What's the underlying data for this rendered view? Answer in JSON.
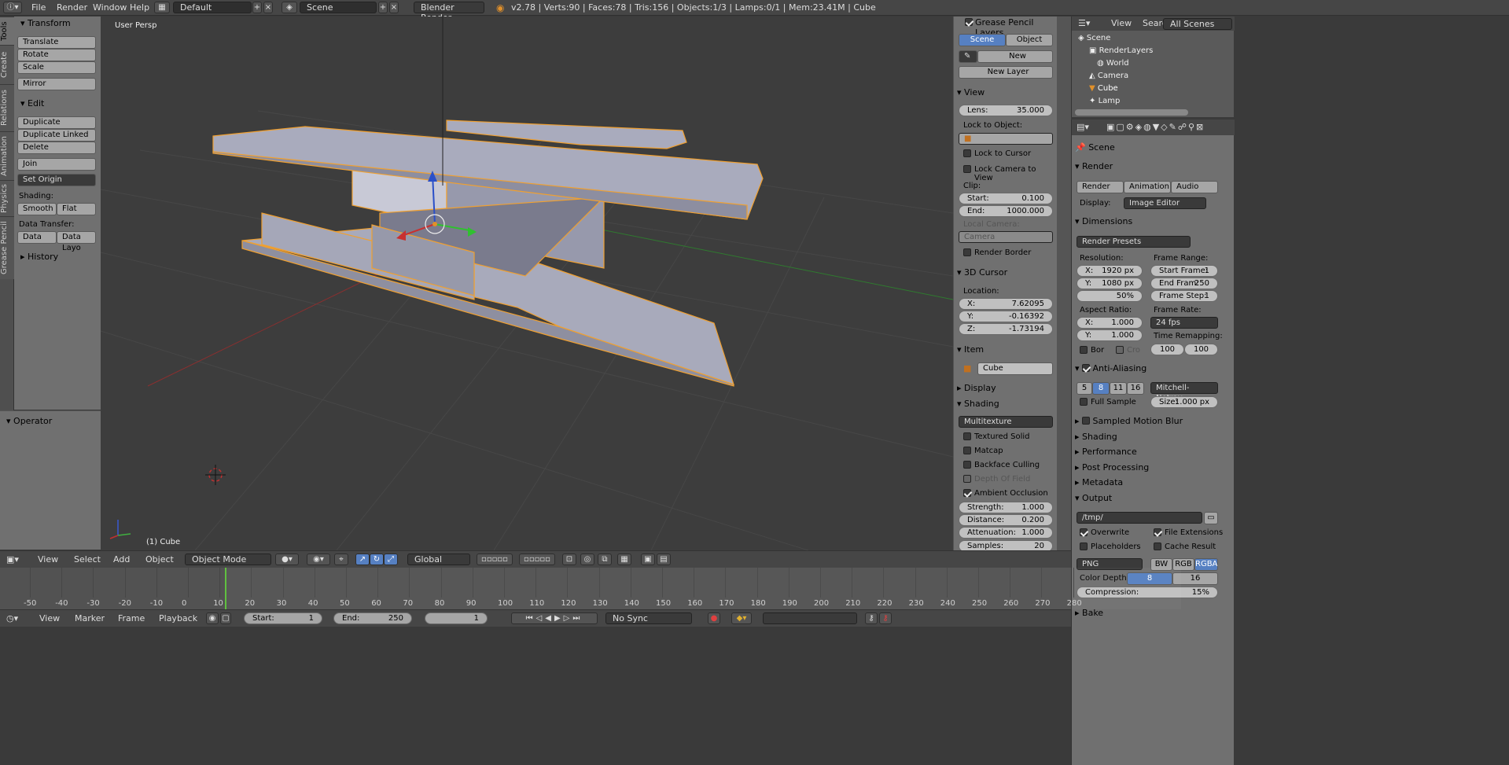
{
  "topbar": {
    "menus": [
      "File",
      "Render",
      "Window",
      "Help"
    ],
    "screen_layout": "Default",
    "scene": "Scene",
    "render_engine": "Blender Render",
    "stats": "v2.78 | Verts:90 | Faces:78 | Tris:156 | Objects:1/3 | Lamps:0/1 | Mem:23.41M | Cube"
  },
  "tool_tabs": [
    "Tools",
    "Create",
    "Relations",
    "Animation",
    "Physics",
    "Grease Pencil"
  ],
  "toolshelf": {
    "transform_title": "Transform",
    "translate": "Translate",
    "rotate": "Rotate",
    "scale": "Scale",
    "mirror": "Mirror",
    "edit_title": "Edit",
    "duplicate": "Duplicate",
    "duplicate_linked": "Duplicate Linked",
    "delete": "Delete",
    "join": "Join",
    "set_origin": "Set Origin",
    "shading_label": "Shading:",
    "smooth": "Smooth",
    "flat": "Flat",
    "data_transfer_label": "Data Transfer:",
    "data": "Data",
    "data_layout": "Data Layo",
    "history_title": "History"
  },
  "operator_title": "Operator",
  "viewport": {
    "view_label": "User Persp",
    "object_label": "(1) Cube"
  },
  "npanel": {
    "grease_pencil_title": "Grease Pencil Layers",
    "scene_btn": "Scene",
    "object_btn": "Object",
    "new_btn": "New",
    "new_layer_btn": "New Layer",
    "view_title": "View",
    "lens_label": "Lens:",
    "lens_value": "35.000",
    "lock_to_object": "Lock to Object:",
    "lock_to_cursor": "Lock to Cursor",
    "lock_camera_to_view": "Lock Camera to View",
    "clip_label": "Clip:",
    "clip_start_label": "Start:",
    "clip_start": "0.100",
    "clip_end_label": "End:",
    "clip_end": "1000.000",
    "local_camera": "Local Camera:",
    "camera_placeholder": "Camera",
    "render_border": "Render Border",
    "cursor_title": "3D Cursor",
    "location_label": "Location:",
    "cx_label": "X:",
    "cx": "7.62095",
    "cy_label": "Y:",
    "cy": "-0.16392",
    "cz_label": "Z:",
    "cz": "-1.73194",
    "item_title": "Item",
    "item_name": "Cube",
    "display_title": "Display",
    "shading_title": "Shading",
    "shading_mode": "Multitexture",
    "textured_solid": "Textured Solid",
    "matcap": "Matcap",
    "backface_culling": "Backface Culling",
    "depth_of_field": "Depth Of Field",
    "ambient_occlusion": "Ambient Occlusion",
    "strength_label": "Strength:",
    "strength": "1.000",
    "distance_label": "Distance:",
    "distance": "0.200",
    "attenuation_label": "Attenuation:",
    "attenuation": "1.000",
    "samples_label": "Samples:",
    "samples": "20"
  },
  "outliner": {
    "view": "View",
    "search": "Search",
    "all_scenes": "All Scenes",
    "items": [
      "Scene",
      "RenderLayers",
      "World",
      "Camera",
      "Cube",
      "Lamp"
    ]
  },
  "properties": {
    "scene_label": "Scene",
    "render_title": "Render",
    "render_btn": "Render",
    "animation_btn": "Animation",
    "audio_btn": "Audio",
    "display_label": "Display:",
    "display_value": "Image Editor",
    "dimensions_title": "Dimensions",
    "render_presets": "Render Presets",
    "resolution_label": "Resolution:",
    "res_x_label": "X:",
    "res_x": "1920 px",
    "res_y_label": "Y:",
    "res_y": "1080 px",
    "res_pct": "50%",
    "frame_range_label": "Frame Range:",
    "start_frame_label": "Start Frame:",
    "start_frame": "1",
    "end_frame_label": "End Fram:",
    "end_frame": "250",
    "frame_step_label": "Frame Step:",
    "frame_step": "1",
    "aspect_label": "Aspect Ratio:",
    "asp_x_label": "X:",
    "asp_x": "1.000",
    "asp_y_label": "Y:",
    "asp_y": "1.000",
    "frame_rate_label": "Frame Rate:",
    "frame_rate": "24 fps",
    "time_remap_label": "Time Remapping:",
    "remap_old": "100",
    "remap_new": "100",
    "bor": "Bor",
    "cro": "Cro",
    "aa_title": "Anti-Aliasing",
    "aa_samples": [
      "5",
      "8",
      "11",
      "16"
    ],
    "aa_filter": "Mitchell-Netrav...",
    "full_sample": "Full Sample",
    "size_label": "Size:",
    "size_value": "1.000 px",
    "motion_blur_title": "Sampled Motion Blur",
    "shading_title": "Shading",
    "performance_title": "Performance",
    "post_processing_title": "Post Processing",
    "metadata_title": "Metadata",
    "output_title": "Output",
    "output_path": "/tmp/",
    "overwrite": "Overwrite",
    "file_extensions": "File Extensions",
    "placeholders": "Placeholders",
    "cache_result": "Cache Result",
    "file_format": "PNG",
    "bw": "BW",
    "rgb": "RGB",
    "rgba": "RGBA",
    "color_depth_label": "Color Depth:",
    "depth_8": "8",
    "depth_16": "16",
    "compression_label": "Compression:",
    "compression": "15%",
    "bake_title": "Bake"
  },
  "vpheader": {
    "view": "View",
    "select": "Select",
    "add": "Add",
    "object": "Object",
    "mode": "Object Mode",
    "orientation": "Global"
  },
  "timeline": {
    "ticks": [
      "-50",
      "-40",
      "-30",
      "-20",
      "-10",
      "0",
      "10",
      "20",
      "30",
      "40",
      "50",
      "60",
      "70",
      "80",
      "90",
      "100",
      "110",
      "120",
      "130",
      "140",
      "150",
      "160",
      "170",
      "180",
      "190",
      "200",
      "210",
      "220",
      "230",
      "240",
      "250",
      "260",
      "270",
      "280"
    ],
    "view": "View",
    "marker": "Marker",
    "frame": "Frame",
    "playback": "Playback",
    "start_label": "Start:",
    "start": "1",
    "end_label": "End:",
    "end": "250",
    "current": "1",
    "sync": "No Sync"
  },
  "colors": {
    "selection_outline": "#f0a030",
    "mesh_face": "#a3a5b8",
    "x_axis": "#b03030",
    "y_axis": "#3a8a2a",
    "active_blue": "#5680c2"
  }
}
